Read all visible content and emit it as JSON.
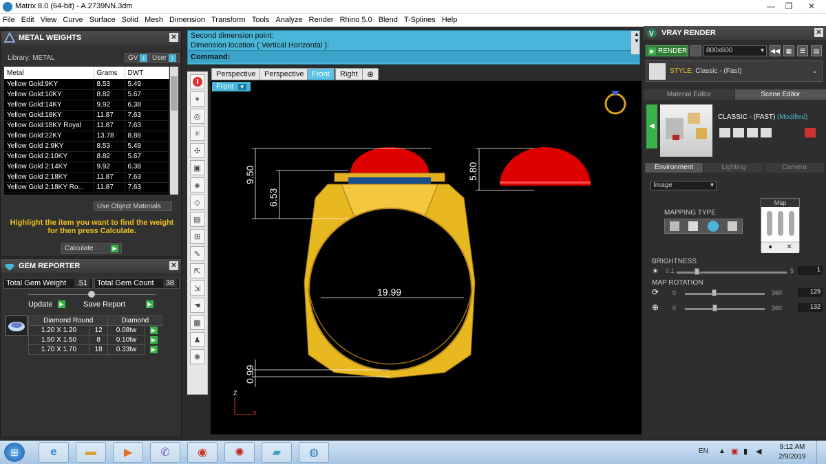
{
  "window": {
    "title": "Matrix 8.0 (64-bit) - A.2739NN.3dm",
    "min": "—",
    "max": "❐",
    "close": "✕"
  },
  "menu": [
    "File",
    "Edit",
    "View",
    "Curve",
    "Surface",
    "Solid",
    "Mesh",
    "Dimension",
    "Transform",
    "Tools",
    "Analyze",
    "Render",
    "Rhino 5.0",
    "Blend",
    "T-Splines",
    "Help"
  ],
  "metal_weights": {
    "title": "METAL WEIGHTS",
    "library_label": "Library: METAL",
    "gv_label": "GV",
    "user_label": "User",
    "columns": [
      "Metal",
      "Grams",
      "DWT"
    ],
    "rows": [
      [
        "Yellow Gold:9KY",
        "8.53",
        "5.49"
      ],
      [
        "Yellow Gold:10KY",
        "8.82",
        "5.67"
      ],
      [
        "Yellow Gold:14KY",
        "9.92",
        "6.38"
      ],
      [
        "Yellow Gold:18KY",
        "11.87",
        "7.63"
      ],
      [
        "Yellow Gold:18KY Royal",
        "11.87",
        "7.63"
      ],
      [
        "Yellow Gold:22KY",
        "13.78",
        "8.86"
      ],
      [
        "Yellow Gold 2:9KY",
        "8.53",
        "5.49"
      ],
      [
        "Yellow Gold 2:10KY",
        "8.82",
        "5.67"
      ],
      [
        "Yellow Gold 2:14KY",
        "9.92",
        "6.38"
      ],
      [
        "Yellow Gold 2:18KY",
        "11.87",
        "7.63"
      ],
      [
        "Yellow Gold 2:18KY Ro...",
        "11.87",
        "7.63"
      ]
    ],
    "use_object_materials": "Use Object Materials",
    "hint": "Highlight the item you want to find the weight for then press Calculate.",
    "calculate": "Calculate"
  },
  "gem_reporter": {
    "title": "GEM REPORTER",
    "total_weight_label": "Total Gem Weight",
    "total_weight": ".51",
    "total_count_label": "Total Gem Count",
    "total_count": "38",
    "update": "Update",
    "save_report": "Save Report",
    "header": [
      "Diamond Round",
      "Diamond"
    ],
    "rows": [
      [
        "1.20 X 1.20",
        "12",
        "0.08tw"
      ],
      [
        "1.50 X 1.50",
        "8",
        "0.10tw"
      ],
      [
        "1.70 X 1.70",
        "18",
        "0.33tw"
      ]
    ]
  },
  "command": {
    "line1": "Second dimension point:",
    "line2": "Dimension location ( Vertical  Horizontal ):",
    "prompt": "Command:"
  },
  "viewport_tabs": [
    "Perspective",
    "Perspective",
    "Front",
    "Right"
  ],
  "viewport_label": "Front",
  "dimensions": {
    "height_total": "9.50",
    "height_inner": "6.53",
    "stone_height": "5.80",
    "inner_diameter": "19.99",
    "band_thickness": "0.99"
  },
  "axis": {
    "z": "Z",
    "x": "X"
  },
  "vray": {
    "title": "VRAY RENDER",
    "render": "RENDER",
    "resolution": "800x600",
    "style_label": "STYLE:",
    "style_value": "Classic - (Fast)",
    "tabs": [
      "Material Editor",
      "Scene Editor"
    ],
    "scene_name": "CLASSIC - (FAST)",
    "modified": "(Modified)",
    "env_tabs": [
      "Environment",
      "Lighting",
      "Camera"
    ],
    "env_type": "Image",
    "mapping_type": "MAPPING TYPE",
    "map_label": "Map",
    "brightness_label": "BRIGHTNESS",
    "brightness_min": "0.1",
    "brightness_max": "5",
    "brightness_value": "1",
    "rotation_label": "MAP ROTATION",
    "rot1_min": "0",
    "rot1_max": "360",
    "rot1_value": "129",
    "rot2_min": "0",
    "rot2_max": "360",
    "rot2_value": "132"
  },
  "taskbar": {
    "lang": "EN",
    "time": "9:12 AM",
    "date": "2/9/2019"
  },
  "colors": {
    "accent_green": "#3bb14a",
    "command_blue": "#49b6d9",
    "gold": "#e8b820",
    "stone_red": "#e00000"
  }
}
